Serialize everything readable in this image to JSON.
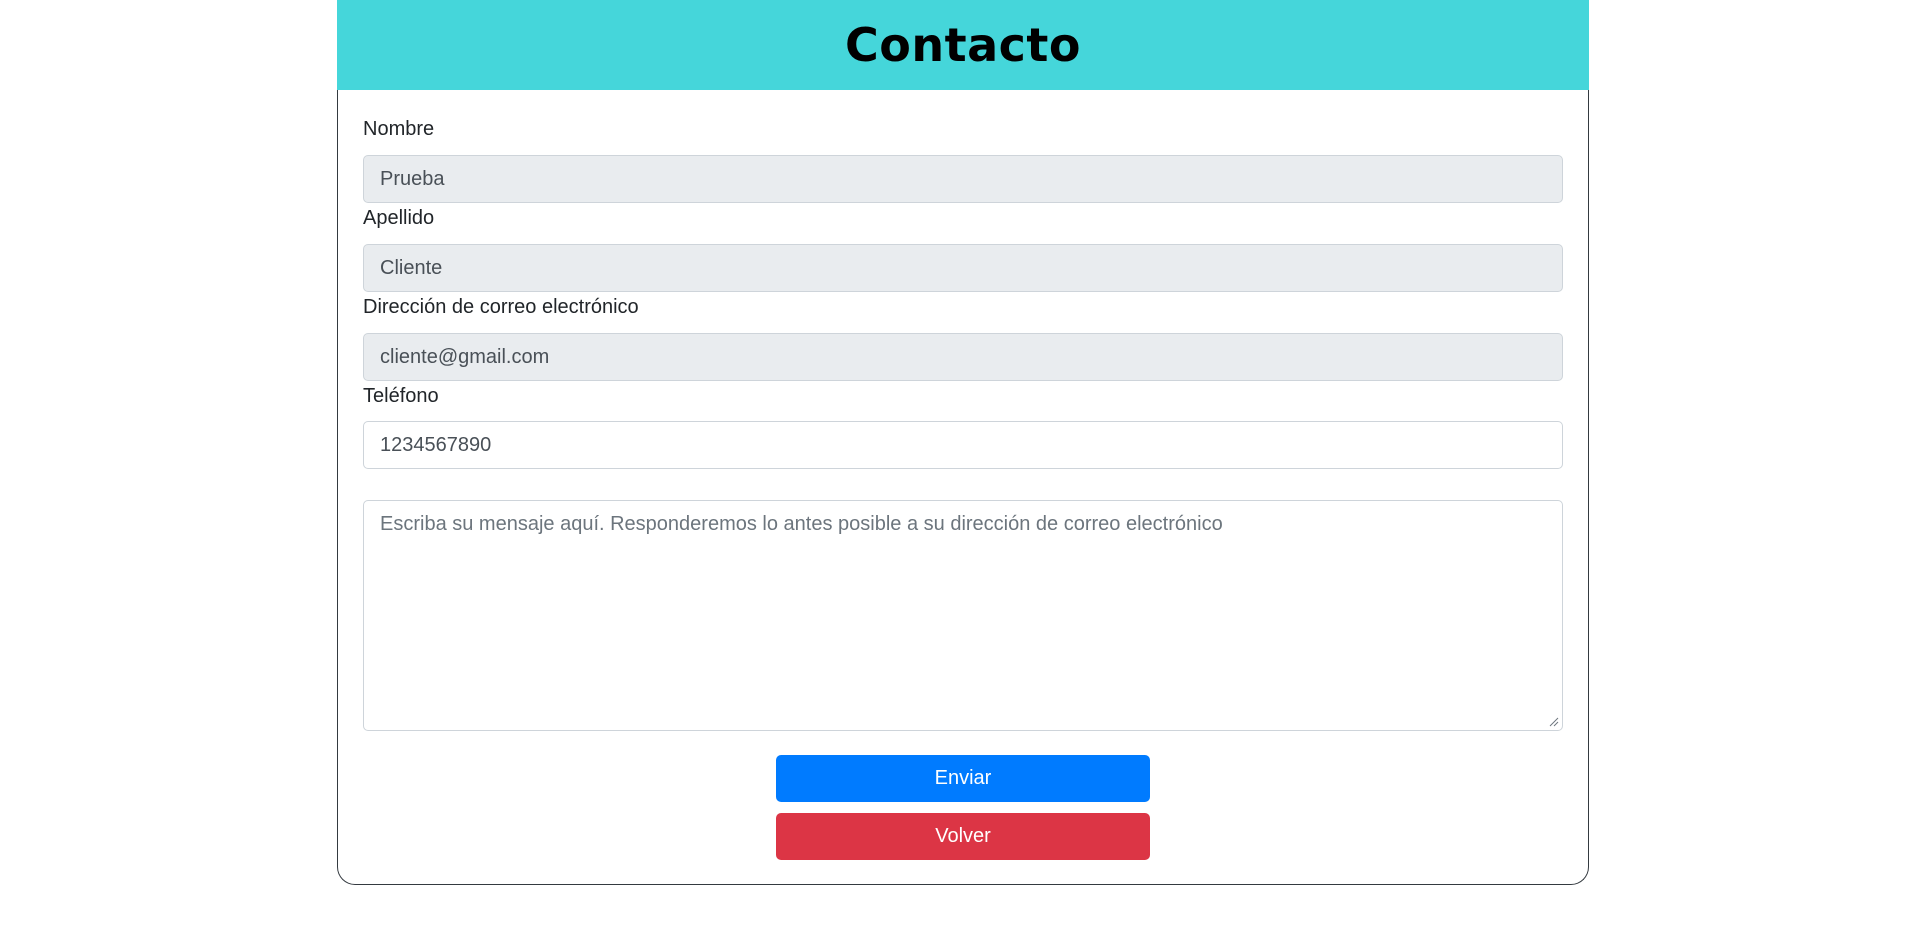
{
  "header": {
    "title": "Contacto",
    "color": "#45d6da"
  },
  "form": {
    "nombre": {
      "label": "Nombre",
      "value": "Prueba",
      "readonly": true
    },
    "apellido": {
      "label": "Apellido",
      "value": "Cliente",
      "readonly": true
    },
    "email": {
      "label": "Dirección de correo electrónico",
      "value": "cliente@gmail.com",
      "readonly": true
    },
    "telefono": {
      "label": "Teléfono",
      "value": "1234567890",
      "readonly": false
    },
    "mensaje": {
      "placeholder": "Escriba su mensaje aquí. Responderemos lo antes posible a su dirección de correo electrónico",
      "value": ""
    }
  },
  "buttons": {
    "send": {
      "label": "Enviar",
      "color": "#007bff"
    },
    "back": {
      "label": "Volver",
      "color": "#dc3545"
    }
  }
}
